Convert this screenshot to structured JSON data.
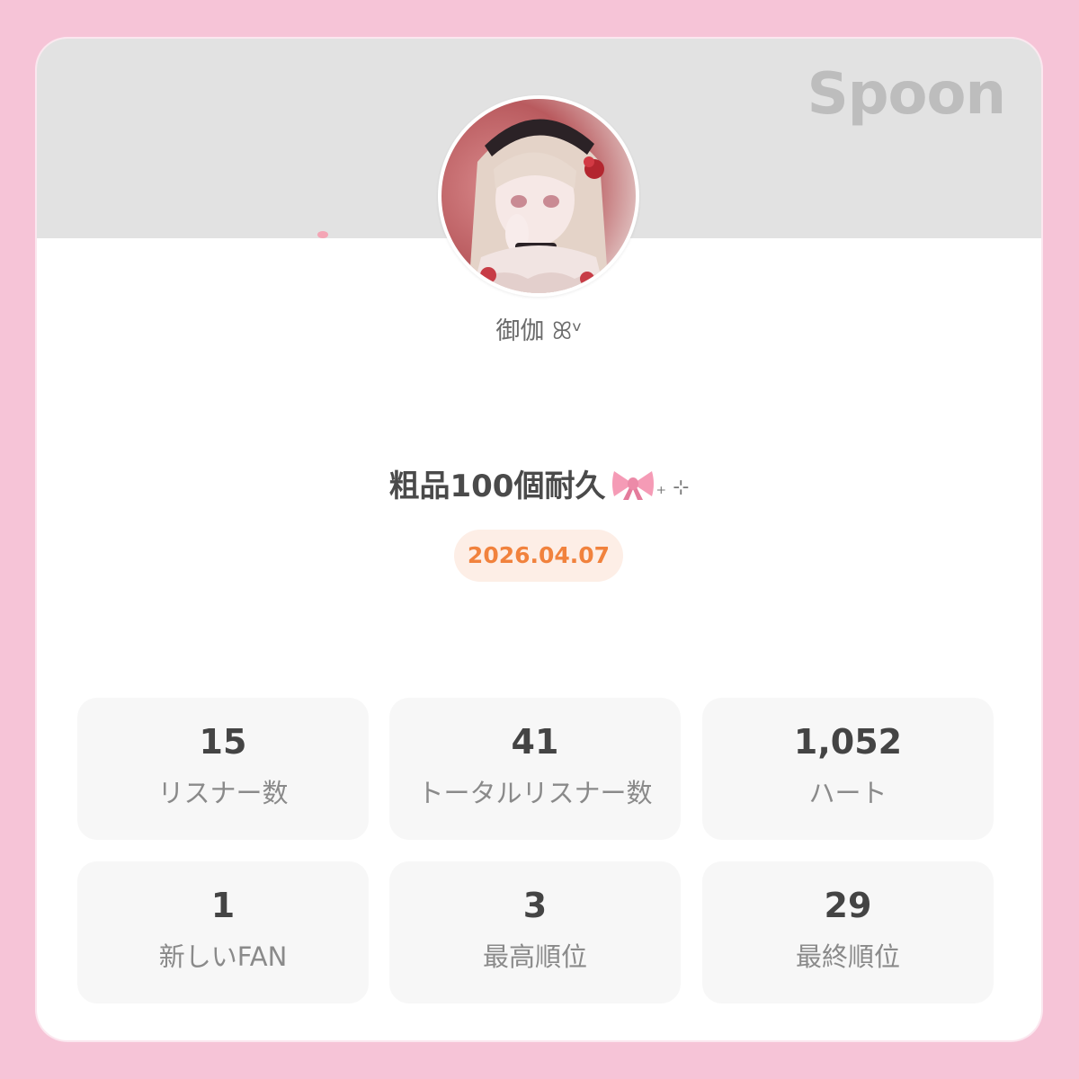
{
  "brand": {
    "logo_text": "Spoon"
  },
  "profile": {
    "username": "御伽 ꕤᵛ",
    "avatar_icon": "anime-avatar-icon"
  },
  "broadcast": {
    "title": "粗品100個耐久",
    "title_decoration": "🎀₊ ⊹",
    "date": "2026.04.07"
  },
  "stats": [
    {
      "value": "15",
      "label": "リスナー数"
    },
    {
      "value": "41",
      "label": "トータルリスナー数"
    },
    {
      "value": "1,052",
      "label": "ハート"
    },
    {
      "value": "1",
      "label": "新しいFAN"
    },
    {
      "value": "3",
      "label": "最高順位"
    },
    {
      "value": "29",
      "label": "最終順位"
    }
  ],
  "colors": {
    "page_background": "#f6c4d7",
    "banner": "#e2e2e2",
    "date_accent": "#f1823d",
    "date_pill_background": "#fdeee6"
  }
}
